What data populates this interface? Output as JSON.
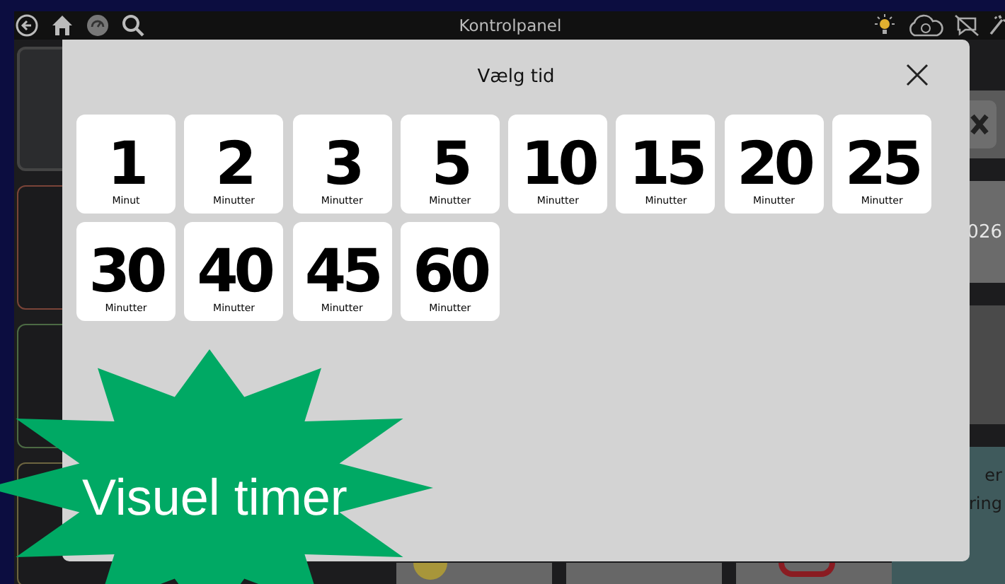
{
  "top_bar": {
    "title": "Kontrolpanel"
  },
  "background": {
    "right_panels": [
      {
        "kind": "close"
      },
      {
        "kind": "text",
        "text": "026"
      },
      {
        "kind": "plain"
      },
      {
        "kind": "text2",
        "lines": [
          "er",
          "ring"
        ]
      }
    ]
  },
  "dialog": {
    "title": "Vælg tid",
    "options": [
      {
        "number": "1",
        "unit": "Minut"
      },
      {
        "number": "2",
        "unit": "Minutter"
      },
      {
        "number": "3",
        "unit": "Minutter"
      },
      {
        "number": "5",
        "unit": "Minutter"
      },
      {
        "number": "10",
        "unit": "Minutter"
      },
      {
        "number": "15",
        "unit": "Minutter"
      },
      {
        "number": "20",
        "unit": "Minutter"
      },
      {
        "number": "25",
        "unit": "Minutter"
      },
      {
        "number": "30",
        "unit": "Minutter"
      },
      {
        "number": "40",
        "unit": "Minutter"
      },
      {
        "number": "45",
        "unit": "Minutter"
      },
      {
        "number": "60",
        "unit": "Minutter"
      }
    ]
  },
  "badge": {
    "text": "Visuel timer"
  }
}
